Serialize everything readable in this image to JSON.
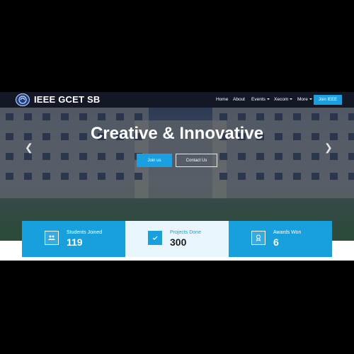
{
  "navbar": {
    "brand": "IEEE GCET SB",
    "items": [
      {
        "label": "Home",
        "dropdown": false
      },
      {
        "label": "About",
        "dropdown": false
      },
      {
        "label": "Events",
        "dropdown": true
      },
      {
        "label": "Xecom",
        "dropdown": true
      },
      {
        "label": "More",
        "dropdown": true
      }
    ],
    "cta_label": "Join IEEE"
  },
  "hero": {
    "title": "Creative & Innovative",
    "primary_button": "Join us",
    "secondary_button": "Contact Us",
    "prev_icon": "chevron-left-icon",
    "next_icon": "chevron-right-icon"
  },
  "stats": [
    {
      "label": "Students Joined",
      "value": "119",
      "icon": "users-icon"
    },
    {
      "label": "Projects Done",
      "value": "300",
      "icon": "check-icon"
    },
    {
      "label": "Awards Won",
      "value": "6",
      "icon": "award-icon"
    }
  ],
  "colors": {
    "accent": "#18a0dd",
    "navbar": "#12162a",
    "stat_highlight": "#e9f6fd",
    "page_background": "#000000"
  }
}
